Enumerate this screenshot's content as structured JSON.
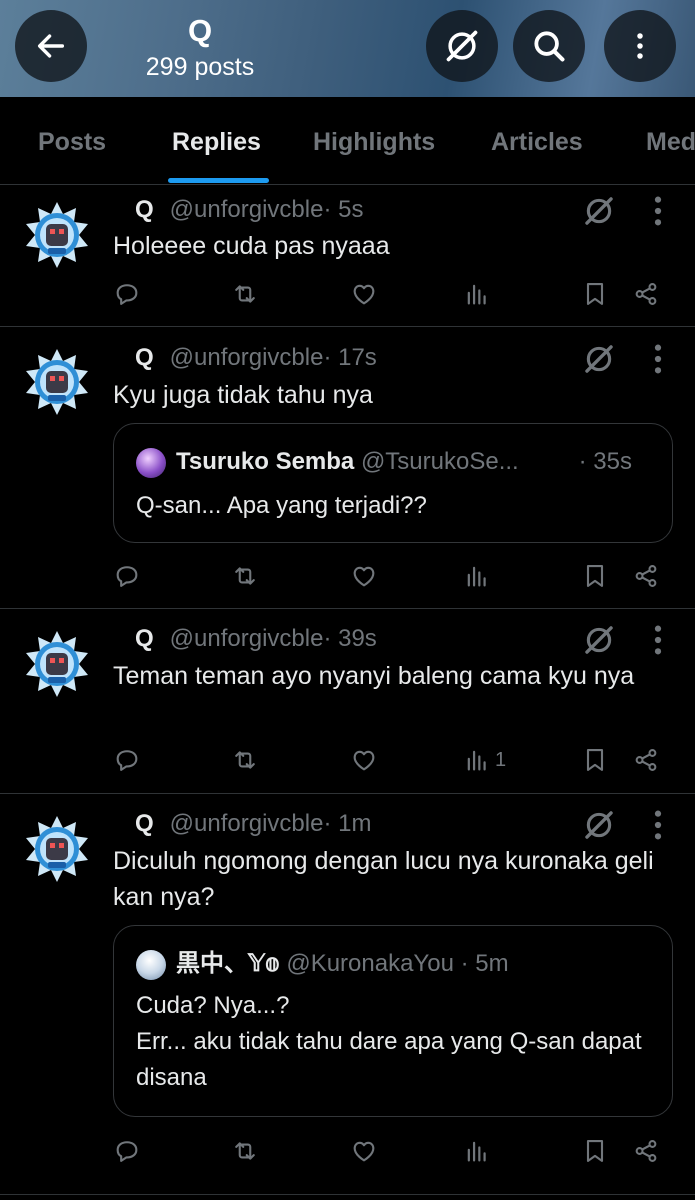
{
  "header": {
    "title": "Q",
    "subtitle": "299 posts"
  },
  "tabs": [
    "Posts",
    "Replies",
    "Highlights",
    "Articles",
    "Media"
  ],
  "icons": [
    "back-arrow-icon",
    "grok-icon",
    "search-icon",
    "more-vertical-icon",
    "reply-icon",
    "repost-icon",
    "like-icon",
    "views-icon",
    "bookmark-icon",
    "share-icon"
  ],
  "colors": {
    "accent": "#1d9bf0",
    "text": "#e7e9ea",
    "muted": "#71767b",
    "border": "#2f3336"
  },
  "posts": [
    {
      "name": "Q",
      "handle": "@unforgivcble",
      "time": "· 5s",
      "text": "Holeeee cuda pas nyaaa",
      "views": ""
    },
    {
      "name": "Q",
      "handle": "@unforgivcble",
      "time": "· 17s",
      "text": "Kyu juga tidak tahu nya",
      "quote": {
        "name": "Tsuruko Semba",
        "handle": "@TsurukoSe...",
        "time": "· 35s",
        "text": "Q-san... Apa yang terjadi??"
      },
      "views": ""
    },
    {
      "name": "Q",
      "handle": "@unforgivcble",
      "time": "· 39s",
      "text": "Teman teman ayo nyanyi baleng cama kyu nya",
      "views": "1"
    },
    {
      "name": "Q",
      "handle": "@unforgivcble",
      "time": "· 1m",
      "text": "Diculuh ngomong dengan lucu nya kuronaka geli kan nya?",
      "quote": {
        "name": "黒中、𝕐𝕠",
        "handle": "@KuronakaYou",
        "time": "· 5m",
        "text": "Cuda? Nya...?\nErr... aku tidak tahu dare apa yang Q-san dapat disana"
      },
      "views": ""
    }
  ]
}
